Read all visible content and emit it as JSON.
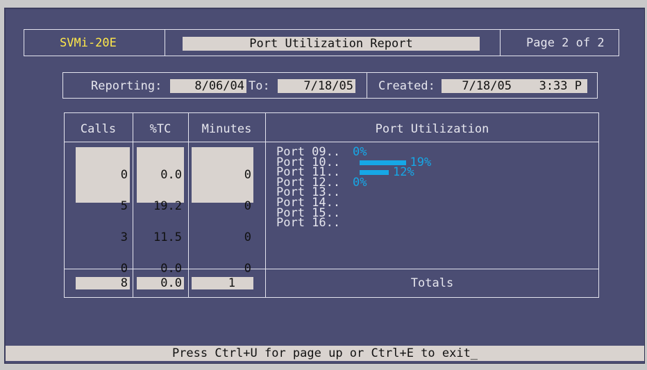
{
  "header": {
    "product": "SVMi-20E",
    "title": "Port Utilization Report",
    "page": "Page 2 of 2"
  },
  "info": {
    "reporting_label": "Reporting:",
    "from_date": "8/06/04",
    "to_label": "To:",
    "to_date": "7/18/05",
    "created_label": "Created:",
    "created_date": "7/18/05",
    "created_time": "3:33 P"
  },
  "table": {
    "columns": [
      "Calls",
      "%TC",
      "Minutes",
      "Port Utilization"
    ],
    "rows": [
      {
        "calls": "0",
        "tc": "0.0",
        "minutes": "0"
      },
      {
        "calls": "5",
        "tc": "19.2",
        "minutes": "0"
      },
      {
        "calls": "3",
        "tc": "11.5",
        "minutes": "0"
      },
      {
        "calls": "0",
        "tc": "0.0",
        "minutes": "0"
      }
    ],
    "ports": [
      {
        "label": "Port 09..",
        "percent": 0,
        "percent_text": "0%"
      },
      {
        "label": "Port 10..",
        "percent": 19,
        "percent_text": "19%"
      },
      {
        "label": "Port 11..",
        "percent": 12,
        "percent_text": "12%"
      },
      {
        "label": "Port 12..",
        "percent": 0,
        "percent_text": "0%"
      },
      {
        "label": "Port 13..",
        "percent": null,
        "percent_text": ""
      },
      {
        "label": "Port 14..",
        "percent": null,
        "percent_text": ""
      },
      {
        "label": "Port 15..",
        "percent": null,
        "percent_text": ""
      },
      {
        "label": "Port 16..",
        "percent": null,
        "percent_text": ""
      }
    ],
    "totals": {
      "calls": "8",
      "tc": "0.0",
      "minutes": "1",
      "label": "Totals"
    }
  },
  "footer": {
    "prompt": "Press Ctrl+U for page up or Ctrl+E to exit_"
  },
  "colors": {
    "background": "#4b4d73",
    "field": "#d9d3cf",
    "accent_yellow": "#ffe84a",
    "bar_blue": "#16a7e6"
  }
}
